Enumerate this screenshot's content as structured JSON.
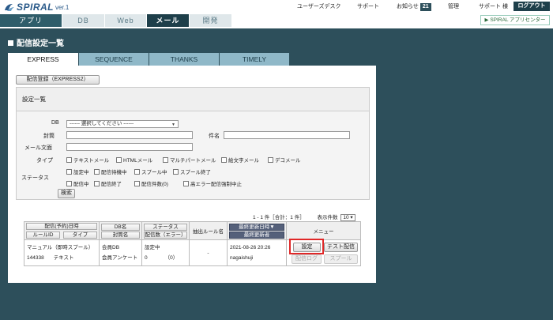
{
  "header": {
    "logo_text": "SPIRAL",
    "logo_version": "ver.1",
    "util_links": [
      "ユーザーズデスク",
      "サポート",
      "お知らせ",
      "管理",
      "サポート 様"
    ],
    "notice_count": "21",
    "logout_label": "ログアウト",
    "app_center_label": "SPIRAL アプリセンター",
    "app_center_arrow": "▶"
  },
  "nav": {
    "tabs": [
      "アプリ",
      "DB",
      "Web",
      "メール",
      "開発"
    ],
    "active": "メール"
  },
  "page": {
    "title": "配信設定一覧",
    "tabs": [
      "EXPRESS",
      "SEQUENCE",
      "THANKS",
      "TIMELY"
    ],
    "active_tab": "EXPRESS",
    "register_button": "配信登録（EXPRESS2）"
  },
  "search": {
    "heading": "設定一覧",
    "db_label": "DB",
    "db_value": "------ 選択してください ------",
    "subject_label": "封筒",
    "name_label": "件名",
    "body_label": "メール文面",
    "type_label": "タイプ",
    "type_options": [
      "テキストメール",
      "HTMLメール",
      "マルチパートメール",
      "絵文字メール",
      "デコメール"
    ],
    "status_label": "ステータス",
    "status_row1": [
      "設定中",
      "配信待機中",
      "スプール中",
      "スプール終了"
    ],
    "status_row2": [
      "配信中",
      "配信終了",
      "配信件数(0)",
      "高エラー配信強制中止"
    ],
    "search_button": "検索"
  },
  "pager": {
    "summary": "1 - 1 件［合計：1 件］",
    "per_page_label": "表示件数",
    "per_page_value": "10"
  },
  "table": {
    "headers": {
      "col1_top": "配信(予約)日時",
      "col1_a": "ルールID",
      "col1_b": "タイプ",
      "col2_top": "DB名",
      "col2_bottom": "封筒名",
      "col3_top": "ステータス",
      "col3_bottom": "配信数（エラー）",
      "col4": "抽出ルール名",
      "col5_top": "最終更新日時▼",
      "col5_bottom": "最終更新者",
      "col6": "メニュー"
    },
    "rows": [
      {
        "schedule": "マニュアル（即時スプール）",
        "rule_id": "144338",
        "type": "テキスト",
        "db_name": "会員DB",
        "envelope": "会員アンケート",
        "status": "設定中",
        "count": "0",
        "errors": "（0）",
        "rule_name": "-",
        "updated_at": "2021-08-26 20:26",
        "updated_by": "nagaishuji",
        "menu": {
          "settings": "設定",
          "test": "テスト配信",
          "log": "配信ログ",
          "spool": "スプール"
        }
      }
    ]
  },
  "colors": {
    "background": "#2d4f5b",
    "active_tab": "#1e3f4a",
    "highlight": "#e02828"
  }
}
